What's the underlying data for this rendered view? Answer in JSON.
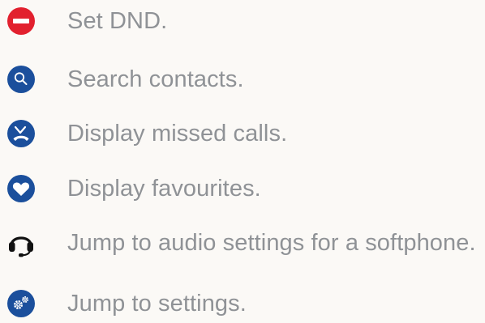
{
  "colors": {
    "dnd_red": "#e2202e",
    "action_blue": "#1b4f9c",
    "headset_black": "#111111",
    "label_gray": "#8f9296",
    "background": "#fbf9f6"
  },
  "items": [
    {
      "icon": "dnd-icon",
      "label": "Set DND."
    },
    {
      "icon": "search-icon",
      "label": "Search contacts."
    },
    {
      "icon": "missed-call-icon",
      "label": "Display missed calls."
    },
    {
      "icon": "heart-icon",
      "label": "Display favourites."
    },
    {
      "icon": "headset-icon",
      "label": "Jump to audio settings for a softphone."
    },
    {
      "icon": "settings-gears-icon",
      "label": "Jump to settings."
    }
  ]
}
